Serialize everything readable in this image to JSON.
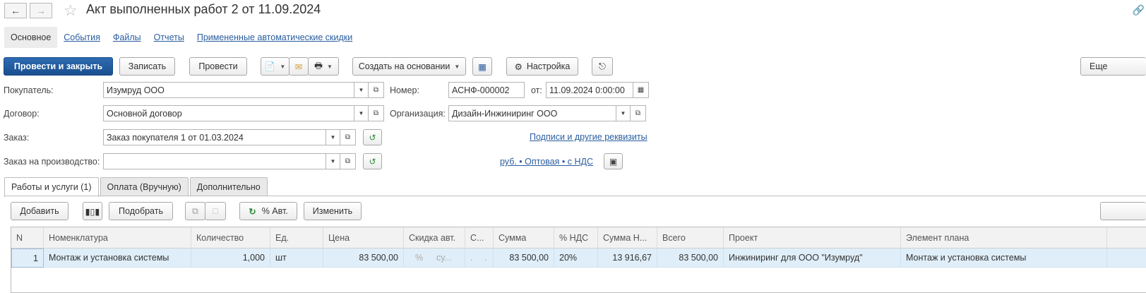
{
  "header": {
    "back_icon": "arrow-left-icon",
    "forward_icon": "arrow-right-icon",
    "title": "Акт выполненных работ 2 от 11.09.2024"
  },
  "top_tabs": [
    "Основное",
    "События",
    "Файлы",
    "Отчеты",
    "Примененные автоматические скидки"
  ],
  "toolbar": {
    "post_close": "Провести и закрыть",
    "save": "Записать",
    "post": "Провести",
    "create_based": "Создать на основании",
    "settings": "Настройка",
    "more": "Еще"
  },
  "form": {
    "buyer_label": "Покупатель:",
    "buyer_value": "Изумруд ООО",
    "contract_label": "Договор:",
    "contract_value": "Основной договор",
    "order_label": "Заказ:",
    "order_value": "Заказ покупателя 1 от 01.03.2024",
    "prod_order_label": "Заказ на производство:",
    "prod_order_value": "",
    "number_label": "Номер:",
    "number_value": "АСНФ-000002",
    "date_label": "от:",
    "date_value": "11.09.2024  0:00:00",
    "org_label": "Организация:",
    "org_value": "Дизайн-Инжиниринг ООО",
    "signatures_link": "Подписи и другие реквизиты",
    "price_link": "руб. • Оптовая • с НДС"
  },
  "inner_tabs": [
    "Работы и услуги (1)",
    "Оплата (Вручную)",
    "Дополнительно"
  ],
  "table_toolbar": {
    "add": "Добавить",
    "pick": "Подобрать",
    "auto_pct": "% Авт.",
    "change": "Изменить"
  },
  "table": {
    "columns": [
      "N",
      "Номенклатура",
      "Количество",
      "Ед.",
      "Цена",
      "Скидка авт.",
      "С...",
      "Сумма",
      "% НДС",
      "Сумма Н...",
      "Всего",
      "Проект",
      "Элемент плана"
    ],
    "rows": [
      [
        "1",
        "Монтаж и установка системы",
        "1,000",
        "шт",
        "83 500,00",
        "%",
        "су...",
        ".",
        ".",
        "83 500,00",
        "20%",
        "13 916,67",
        "83 500,00",
        "Инжиниринг для ООО \"Изумруд\"",
        "Монтаж и установка системы"
      ]
    ]
  }
}
